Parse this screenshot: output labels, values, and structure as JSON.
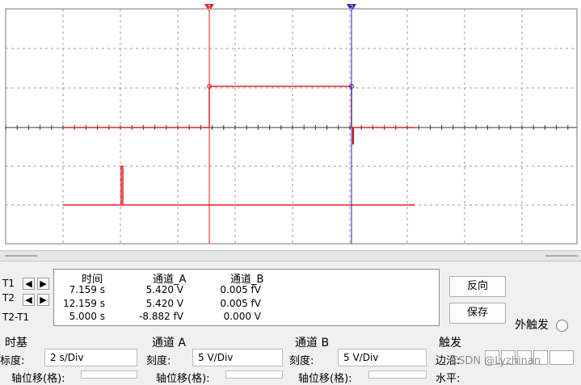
{
  "cursors": {
    "t1_marker": "1",
    "t2_marker": "2"
  },
  "measurements": {
    "headers": [
      "时间",
      "通道_A",
      "通道_B"
    ],
    "rows": [
      {
        "label": "T1",
        "time": "7.159 s",
        "channel_a": "5.420 V",
        "channel_b": "0.005 fV"
      },
      {
        "label": "T2",
        "time": "12.159 s",
        "channel_a": "5.420 V",
        "channel_b": "0.005 fV"
      },
      {
        "label": "T2-T1",
        "time": "5.000 s",
        "channel_a": "-8.882 fV",
        "channel_b": "0.000 V"
      }
    ]
  },
  "buttons": {
    "reverse": "反向",
    "save": "保存"
  },
  "external_trigger": {
    "label": "外触发"
  },
  "timebase": {
    "title": "时基",
    "scale_label": "标度:",
    "scale_value": "2  s/Div",
    "offset_label": "轴位移(格):"
  },
  "channel_a": {
    "title": "通道 A",
    "scale_label": "刻度:",
    "scale_value": "5  V/Div",
    "offset_label": "轴位移(格):"
  },
  "channel_b": {
    "title": "通道 B",
    "scale_label": "刻度:",
    "scale_value": "5  V/Div",
    "offset_label": "轴位移(格):"
  },
  "trigger": {
    "title": "触发",
    "edge_label": "边沿:",
    "level_label": "水平:"
  },
  "watermark": "CSDN @Lyzhinan",
  "colors": {
    "trace_a": "#e02020",
    "cursor_t1": "#e02020",
    "cursor_t2": "#2020c0",
    "grid": "#9a9a9a"
  }
}
